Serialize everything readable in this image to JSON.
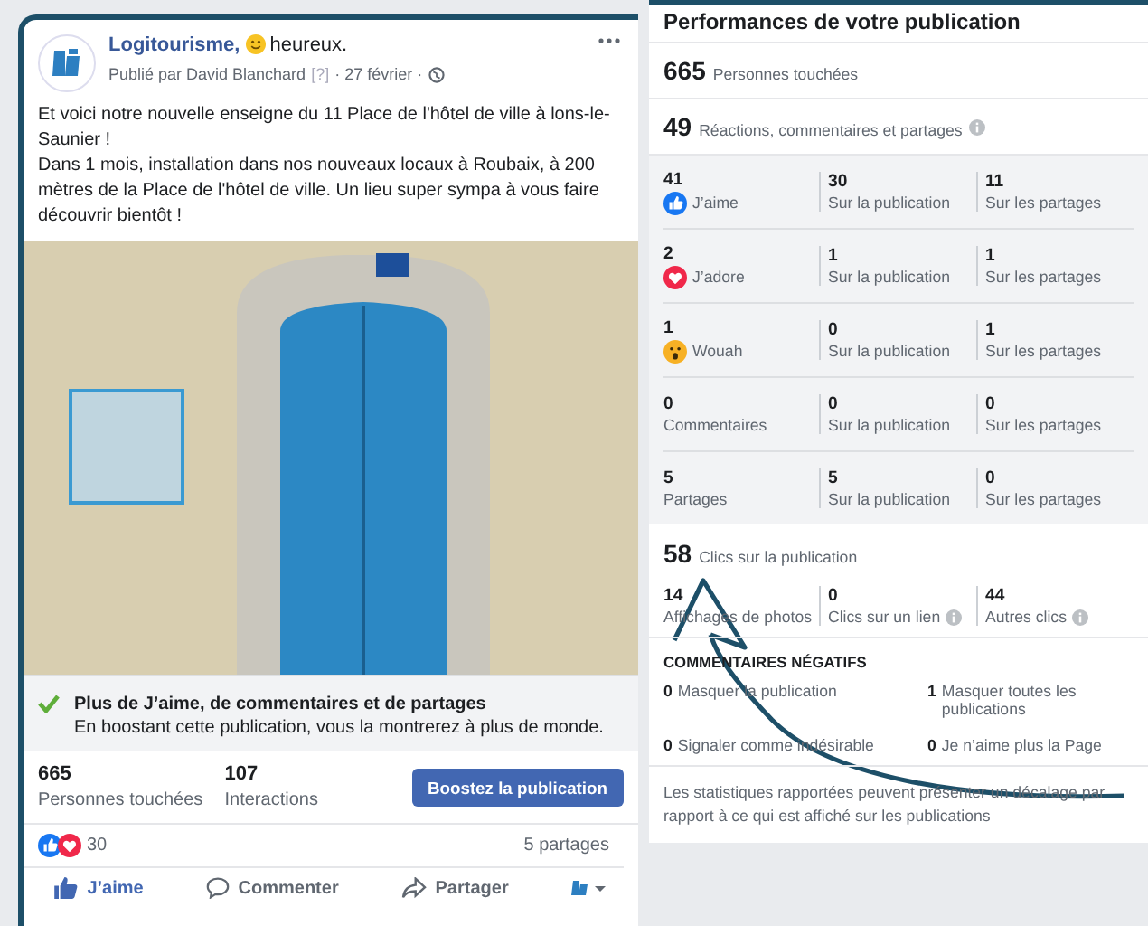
{
  "post": {
    "page_name": "Logitourisme,",
    "feeling": "heureux.",
    "published_by": "Publié par David Blanchard",
    "help_mark": "[?]",
    "date": "· 27 février ·",
    "paragraphs": [
      "Et voici notre nouvelle enseigne du 11 Place de l'hôtel de ville à lons-le-Saunier !",
      "Dans 1 mois, installation dans nos nouveaux locaux à Roubaix, à 200 mètres de la Place de l'hôtel de ville. Un lieu super sympa à vous faire découvrir bientôt !"
    ],
    "boost_tip": {
      "title": "Plus de J’aime, de commentaires et de partages",
      "text": "En boostant cette publication, vous la montrerez à plus de monde."
    },
    "stats": [
      {
        "value": "665",
        "label": "Personnes touchées"
      },
      {
        "value": "107",
        "label": "Interactions"
      }
    ],
    "boost_button": "Boostez la publication",
    "reaction_count": "30",
    "shares": "5 partages",
    "actions": [
      {
        "kind": "like",
        "label": "J’aime"
      },
      {
        "kind": "comment",
        "label": "Commenter"
      },
      {
        "kind": "share",
        "label": "Partager"
      }
    ]
  },
  "insights": {
    "title": "Performances de votre publication",
    "reach": {
      "value": "665",
      "label": "Personnes touchées"
    },
    "engagement": {
      "value": "49",
      "label": "Réactions, commentaires et partages"
    },
    "rows": [
      {
        "kind": "like",
        "value": "41",
        "label": "J’aime",
        "post_value": "30",
        "post_label": "Sur la publication",
        "shares_value": "11",
        "shares_label": "Sur les partages"
      },
      {
        "kind": "love",
        "value": "2",
        "label": "J’adore",
        "post_value": "1",
        "post_label": "Sur la publication",
        "shares_value": "1",
        "shares_label": "Sur les partages"
      },
      {
        "kind": "wow",
        "value": "1",
        "label": "Wouah",
        "post_value": "0",
        "post_label": "Sur la publication",
        "shares_value": "1",
        "shares_label": "Sur les partages"
      },
      {
        "kind": "plain",
        "value": "0",
        "label": "Commentaires",
        "post_value": "0",
        "post_label": "Sur la publication",
        "shares_value": "0",
        "shares_label": "Sur les partages"
      },
      {
        "kind": "plain",
        "value": "5",
        "label": "Partages",
        "post_value": "5",
        "post_label": "Sur la publication",
        "shares_value": "0",
        "shares_label": "Sur les partages"
      }
    ],
    "clicks": {
      "value": "58",
      "label": "Clics sur la publication"
    },
    "click_breakdown": [
      {
        "value": "14",
        "label": "Affichages de photos",
        "info": false
      },
      {
        "value": "0",
        "label": "Clics sur un lien",
        "info": true
      },
      {
        "value": "44",
        "label": "Autres clics",
        "info": true
      }
    ],
    "negative": {
      "title": "COMMENTAIRES NÉGATIFS",
      "items": [
        {
          "value": "0",
          "label": "Masquer la publication"
        },
        {
          "value": "1",
          "label": "Masquer toutes les publications"
        },
        {
          "value": "0",
          "label": "Signaler comme indésirable"
        },
        {
          "value": "0",
          "label": "Je n’aime plus la Page"
        }
      ]
    },
    "footnote": "Les statistiques rapportées peuvent présenter un décalage par rapport à ce qui est affiché sur les publications"
  }
}
